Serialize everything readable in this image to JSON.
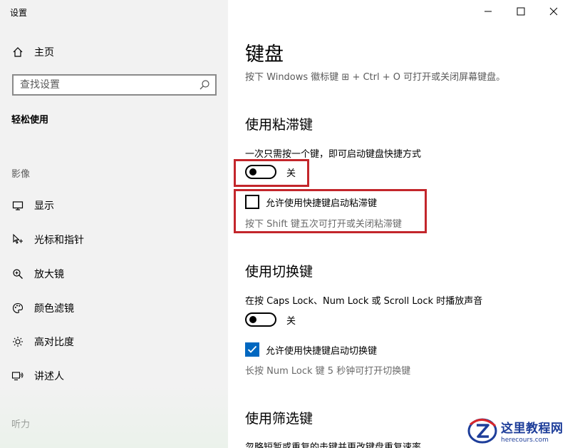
{
  "window": {
    "title": "设置"
  },
  "sidebar": {
    "home_label": "主页",
    "search_placeholder": "查找设置",
    "category": "轻松使用",
    "group_vision": "影像",
    "items": [
      {
        "label": "显示",
        "icon": "monitor-icon"
      },
      {
        "label": "光标和指针",
        "icon": "cursor-icon"
      },
      {
        "label": "放大镜",
        "icon": "magnifier-icon"
      },
      {
        "label": "颜色滤镜",
        "icon": "palette-icon"
      },
      {
        "label": "高对比度",
        "icon": "sun-icon"
      },
      {
        "label": "讲述人",
        "icon": "narrator-icon"
      }
    ],
    "group_hearing": "听力"
  },
  "main": {
    "title": "键盘",
    "subtitle": "按下 Windows 徽标键 ⊞ + Ctrl + O 可打开或关闭屏幕键盘。",
    "sticky": {
      "heading": "使用粘滞键",
      "desc": "一次只需按一个键，即可启动键盘快捷方式",
      "toggle_state": "关",
      "toggle_on": false,
      "checkbox_label": "允许使用快捷键启动粘滞键",
      "checkbox_checked": false,
      "hint": "按下 Shift 键五次可打开或关闭粘滞键"
    },
    "toggle_keys": {
      "heading": "使用切换键",
      "desc": "在按 Caps Lock、Num Lock 或 Scroll Lock 时播放声音",
      "toggle_state": "关",
      "toggle_on": false,
      "checkbox_label": "允许使用快捷键启动切换键",
      "checkbox_checked": true,
      "hint": "长按 Num Lock 键 5 秒钟可打开切换键"
    },
    "filter_keys": {
      "heading": "使用筛选键",
      "desc": "忽略短暂或重复的击键并更改键盘重复速率"
    }
  },
  "watermark": {
    "text": "这里教程网",
    "url": "herecours.com"
  },
  "colors": {
    "accent": "#0067c0",
    "annotation": "#c3262b",
    "sidebar_bg": "#f2f2f2"
  }
}
